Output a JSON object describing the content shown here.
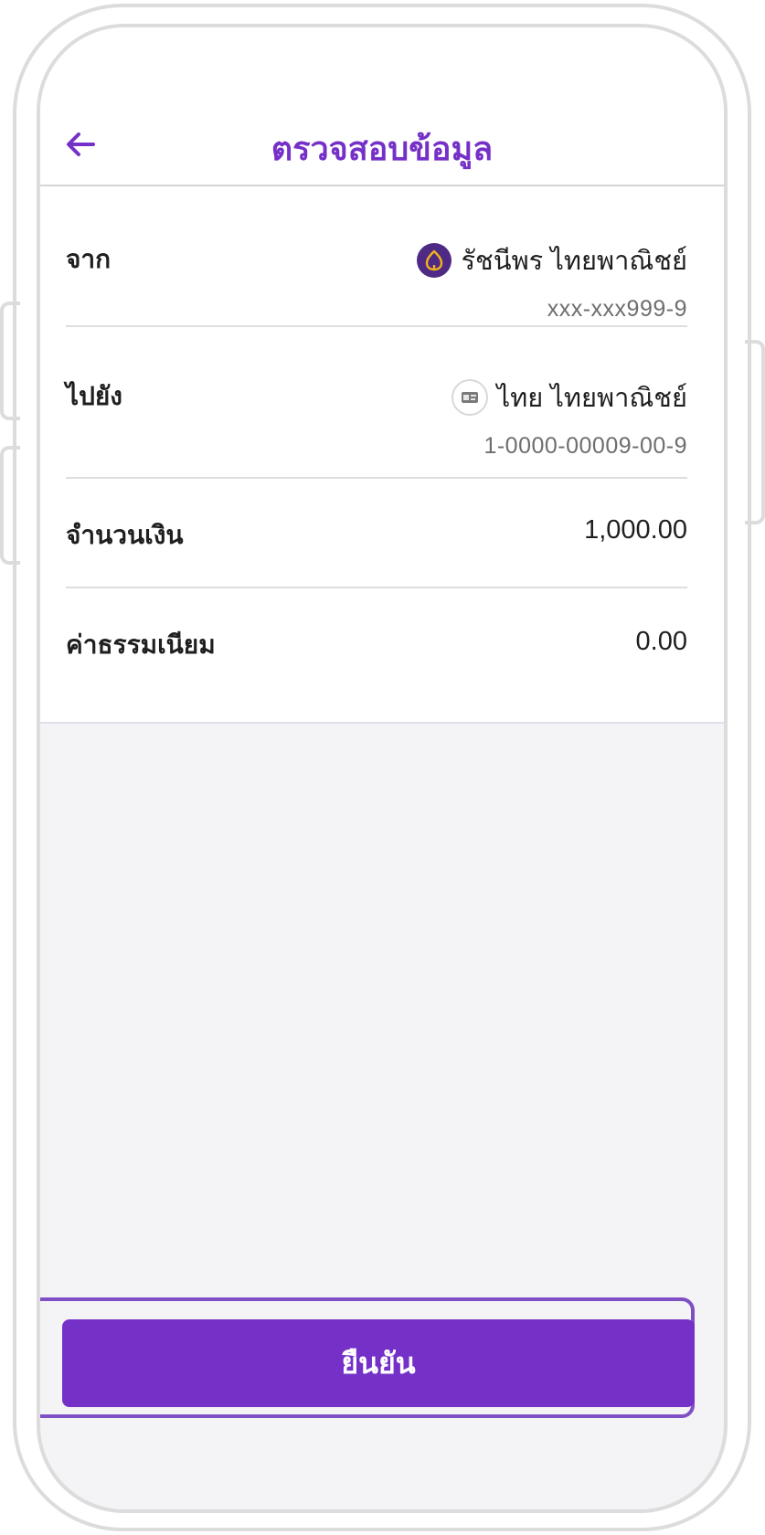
{
  "header": {
    "title": "ตรวจสอบข้อมูล",
    "back_icon": "arrow-left-icon"
  },
  "from": {
    "label": "จาก",
    "name": "รัชนีพร ไทยพาณิชย์",
    "account": "xxx-xxx999-9",
    "icon": "bank-logo-icon"
  },
  "to": {
    "label": "ไปยัง",
    "name": "ไทย ไทยพาณิชย์",
    "account": "1-0000-00009-00-9",
    "icon": "id-card-icon"
  },
  "amount": {
    "label": "จำนวนเงิน",
    "value": "1,000.00"
  },
  "fee": {
    "label": "ค่าธรรมเนียม",
    "value": "0.00"
  },
  "confirm": {
    "label": "ยืนยัน"
  },
  "colors": {
    "accent": "#7530c8",
    "background": "#f4f4f7"
  }
}
